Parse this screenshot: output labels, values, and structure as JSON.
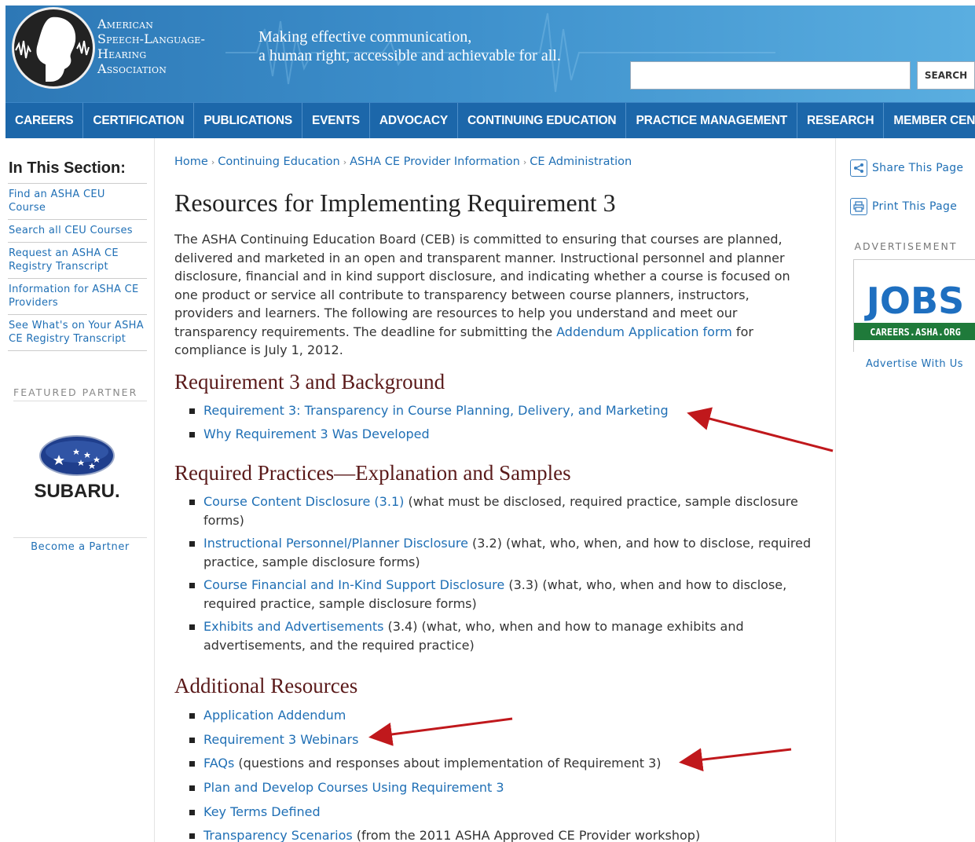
{
  "header": {
    "org_name_lines": [
      "American",
      "Speech-Language-",
      "Hearing",
      "Association"
    ],
    "tagline_lines": [
      "Making effective communication,",
      "a human right, accessible and achievable for all."
    ],
    "search_placeholder": "",
    "search_button": "SEARCH"
  },
  "nav": {
    "items": [
      "CAREERS",
      "CERTIFICATION",
      "PUBLICATIONS",
      "EVENTS",
      "ADVOCACY",
      "CONTINUING EDUCATION",
      "PRACTICE MANAGEMENT",
      "RESEARCH",
      "MEMBER CENTER"
    ]
  },
  "sidebar": {
    "title": "In This Section:",
    "items": [
      "Find an ASHA CEU Course",
      "Search all CEU Courses",
      "Request an ASHA CE Registry Transcript",
      "Information for ASHA CE Providers",
      "See What's on Your ASHA CE Registry Transcript"
    ],
    "featured_label": "FEATURED PARTNER",
    "partner_logo_text": "SUBARU.",
    "partner_link": "Become a Partner"
  },
  "breadcrumb": [
    "Home",
    "Continuing Education",
    "ASHA CE Provider Information",
    "CE Administration"
  ],
  "page_title": "Resources for Implementing Requirement 3",
  "intro": {
    "before_link": "The ASHA Continuing Education Board (CEB) is committed to ensuring that courses are planned, delivered and marketed in an open and transparent manner. Instructional personnel and planner disclosure, financial and in kind support disclosure, and indicating whether a course is focused on one product or service all contribute to transparency between course planners, instructors, providers and learners. The following are resources to help you understand and meet our transparency requirements. The deadline for submitting the ",
    "link": "Addendum Application form",
    "after_link": " for compliance is July 1, 2012."
  },
  "sections": [
    {
      "heading": "Requirement 3 and Background",
      "items": [
        {
          "link": "Requirement 3: Transparency in Course Planning, Delivery, and Marketing",
          "text": ""
        },
        {
          "link": "Why Requirement 3 Was Developed",
          "text": ""
        }
      ]
    },
    {
      "heading": "Required Practices—Explanation and Samples",
      "items": [
        {
          "link": "Course Content Disclosure (3.1)",
          "text": " (what must be disclosed, required practice, sample disclosure forms)"
        },
        {
          "link": "Instructional Personnel/Planner Disclosure",
          "text": " (3.2) (what, who, when, and how to disclose, required practice, sample disclosure forms)"
        },
        {
          "link": "Course Financial and In-Kind Support Disclosure",
          "text": " (3.3) (what, who, when and how to disclose, required practice, sample disclosure forms)"
        },
        {
          "link": "Exhibits and Advertisements",
          "text": " (3.4) (what, who, when and how to manage exhibits and advertisements, and the required practice)"
        }
      ]
    },
    {
      "heading": "Additional Resources",
      "items": [
        {
          "link": "Application Addendum",
          "text": ""
        },
        {
          "link": "Requirement 3 Webinars",
          "text": ""
        },
        {
          "link": "FAQs",
          "text": " (questions and responses about implementation of Requirement 3)"
        },
        {
          "link": "Plan and Develop Courses Using Requirement 3",
          "text": ""
        },
        {
          "link": "Key Terms Defined",
          "text": ""
        },
        {
          "link": "Transparency Scenarios",
          "text": " (from the 2011 ASHA Approved CE Provider workshop)"
        }
      ]
    }
  ],
  "right": {
    "share": "Share This Page",
    "print": "Print This Page",
    "ad_label": "ADVERTISEMENT",
    "ad_title": "JOBS",
    "ad_subtitle": "CAREERS.ASHA.ORG",
    "ad_link": "Advertise With Us"
  },
  "colors": {
    "nav_bg": "#1c67aa",
    "link": "#1f6fb5",
    "heading": "#5a1a1a",
    "annotation_arrow": "#c0181c",
    "ad_green": "#1f7a3a",
    "ad_blue": "#1e6fc0"
  }
}
